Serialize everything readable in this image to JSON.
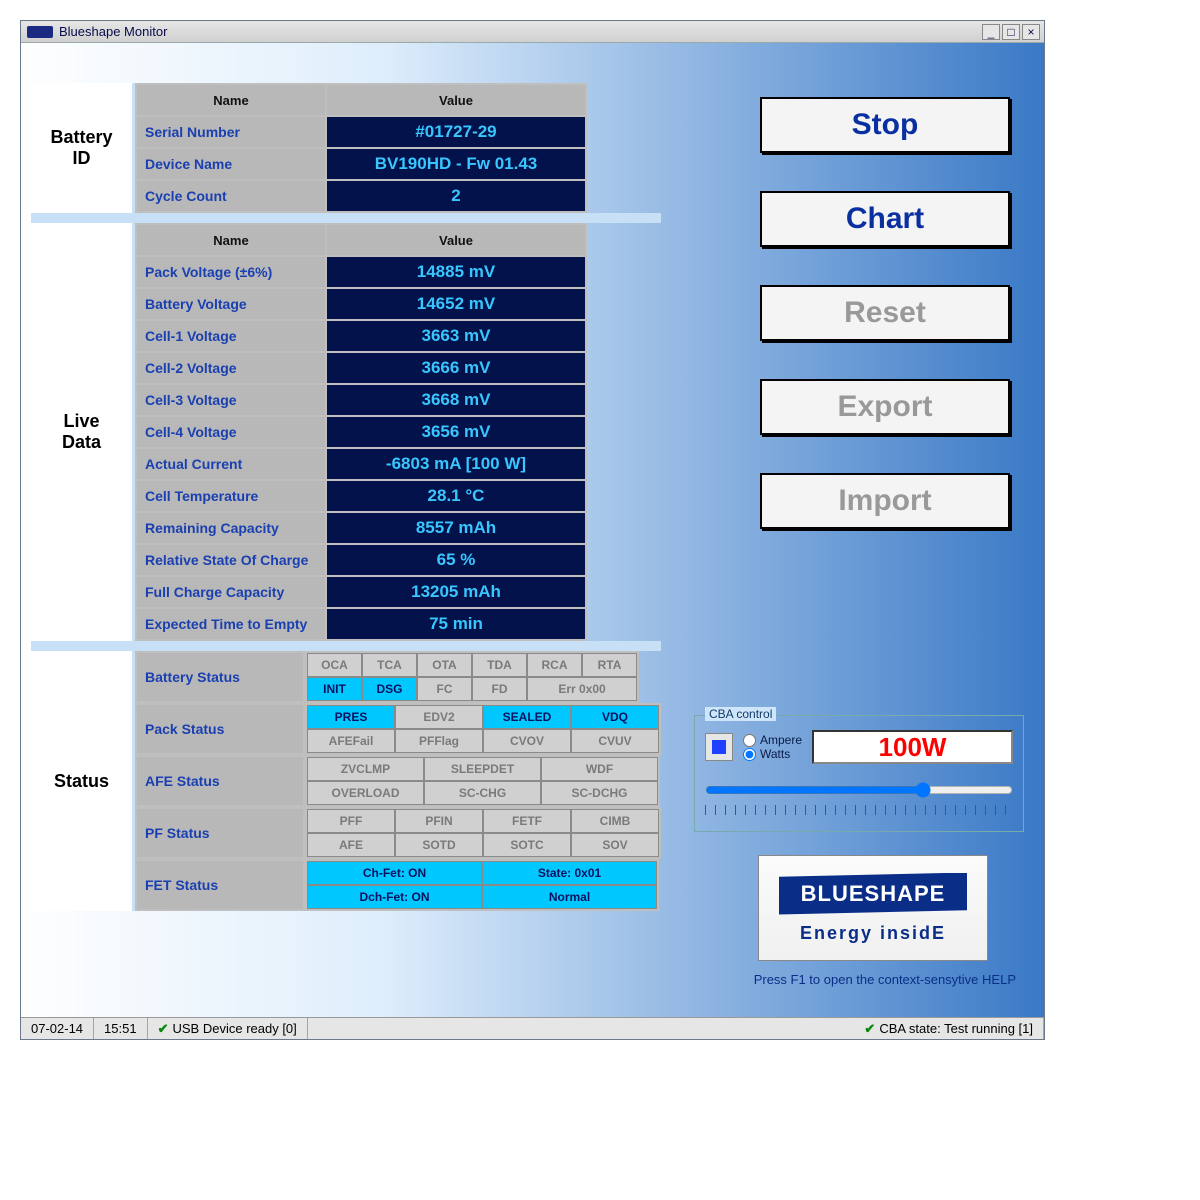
{
  "window": {
    "title": "Blueshape Monitor"
  },
  "headers": {
    "name": "Name",
    "value": "Value"
  },
  "battery_id": {
    "label": "Battery\nID",
    "rows": [
      {
        "name": "Serial Number",
        "value": "#01727-29"
      },
      {
        "name": "Device Name",
        "value": "BV190HD - Fw 01.43"
      },
      {
        "name": "Cycle Count",
        "value": "2"
      }
    ]
  },
  "live_data": {
    "label": "Live\nData",
    "rows": [
      {
        "name": "Pack Voltage (±6%)",
        "value": "14885 mV"
      },
      {
        "name": "Battery Voltage",
        "value": "14652 mV"
      },
      {
        "name": "Cell-1 Voltage",
        "value": "3663 mV"
      },
      {
        "name": "Cell-2 Voltage",
        "value": "3666 mV"
      },
      {
        "name": "Cell-3 Voltage",
        "value": "3668 mV"
      },
      {
        "name": "Cell-4 Voltage",
        "value": "3656 mV"
      },
      {
        "name": "Actual Current",
        "value": "-6803 mA  [100 W]"
      },
      {
        "name": "Cell Temperature",
        "value": "28.1 °C"
      },
      {
        "name": "Remaining Capacity",
        "value": "8557 mAh"
      },
      {
        "name": "Relative State Of Charge",
        "value": "65 %"
      },
      {
        "name": "Full Charge Capacity",
        "value": "13205 mAh"
      },
      {
        "name": "Expected Time to Empty",
        "value": "75 min"
      }
    ]
  },
  "status": {
    "label": "Status",
    "rows": [
      {
        "label": "Battery Status",
        "lines": [
          [
            {
              "t": "OCA",
              "a": false
            },
            {
              "t": "TCA",
              "a": false
            },
            {
              "t": "OTA",
              "a": false
            },
            {
              "t": "TDA",
              "a": false
            },
            {
              "t": "RCA",
              "a": false
            },
            {
              "t": "RTA",
              "a": false
            }
          ],
          [
            {
              "t": "INIT",
              "a": true
            },
            {
              "t": "DSG",
              "a": true
            },
            {
              "t": "FC",
              "a": false
            },
            {
              "t": "FD",
              "a": false
            },
            {
              "t": "Err 0x00",
              "a": false,
              "w": 2
            }
          ]
        ]
      },
      {
        "label": "Pack Status",
        "lines": [
          [
            {
              "t": "PRES",
              "a": true,
              "cls": "row2"
            },
            {
              "t": "EDV2",
              "a": false,
              "cls": "row2"
            },
            {
              "t": "SEALED",
              "a": true,
              "cls": "row2"
            },
            {
              "t": "VDQ",
              "a": true,
              "cls": "row2"
            }
          ],
          [
            {
              "t": "AFEFail",
              "a": false,
              "cls": "row2"
            },
            {
              "t": "PFFlag",
              "a": false,
              "cls": "row2"
            },
            {
              "t": "CVOV",
              "a": false,
              "cls": "row2"
            },
            {
              "t": "CVUV",
              "a": false,
              "cls": "row2"
            }
          ]
        ]
      },
      {
        "label": "AFE Status",
        "lines": [
          [
            {
              "t": "ZVCLMP",
              "a": false,
              "cls": "row3"
            },
            {
              "t": "SLEEPDET",
              "a": false,
              "cls": "row3"
            },
            {
              "t": "WDF",
              "a": false,
              "cls": "row3"
            }
          ],
          [
            {
              "t": "OVERLOAD",
              "a": false,
              "cls": "row3"
            },
            {
              "t": "SC-CHG",
              "a": false,
              "cls": "row3"
            },
            {
              "t": "SC-DCHG",
              "a": false,
              "cls": "row3"
            }
          ]
        ]
      },
      {
        "label": "PF Status",
        "lines": [
          [
            {
              "t": "PFF",
              "a": false,
              "cls": "row2"
            },
            {
              "t": "PFIN",
              "a": false,
              "cls": "row2"
            },
            {
              "t": "FETF",
              "a": false,
              "cls": "row2"
            },
            {
              "t": "CIMB",
              "a": false,
              "cls": "row2"
            }
          ],
          [
            {
              "t": "AFE",
              "a": false,
              "cls": "row2"
            },
            {
              "t": "SOTD",
              "a": false,
              "cls": "row2"
            },
            {
              "t": "SOTC",
              "a": false,
              "cls": "row2"
            },
            {
              "t": "SOV",
              "a": false,
              "cls": "row2"
            }
          ]
        ]
      },
      {
        "label": "FET Status",
        "lines": [
          [
            {
              "t": "Ch-Fet: ON",
              "a": true,
              "cls": "wide"
            },
            {
              "t": "State: 0x01",
              "a": true,
              "cls": "wide"
            }
          ],
          [
            {
              "t": "Dch-Fet: ON",
              "a": true,
              "cls": "wide"
            },
            {
              "t": "Normal",
              "a": true,
              "cls": "wide"
            }
          ]
        ]
      }
    ]
  },
  "buttons": {
    "stop": "Stop",
    "chart": "Chart",
    "reset": "Reset",
    "export": "Export",
    "import": "Import"
  },
  "cba": {
    "legend": "CBA control",
    "ampere": "Ampere",
    "watts": "Watts",
    "selected": "watts",
    "readout": "100W"
  },
  "brand": {
    "name": "BLUESHAPE",
    "sub": "Energy insidE"
  },
  "help_hint": "Press F1 to open the context-sensytive HELP",
  "statusbar": {
    "date": "07-02-14",
    "time": "15:51",
    "usb": "USB Device ready [0]",
    "cba": "CBA state: Test running [1]"
  }
}
